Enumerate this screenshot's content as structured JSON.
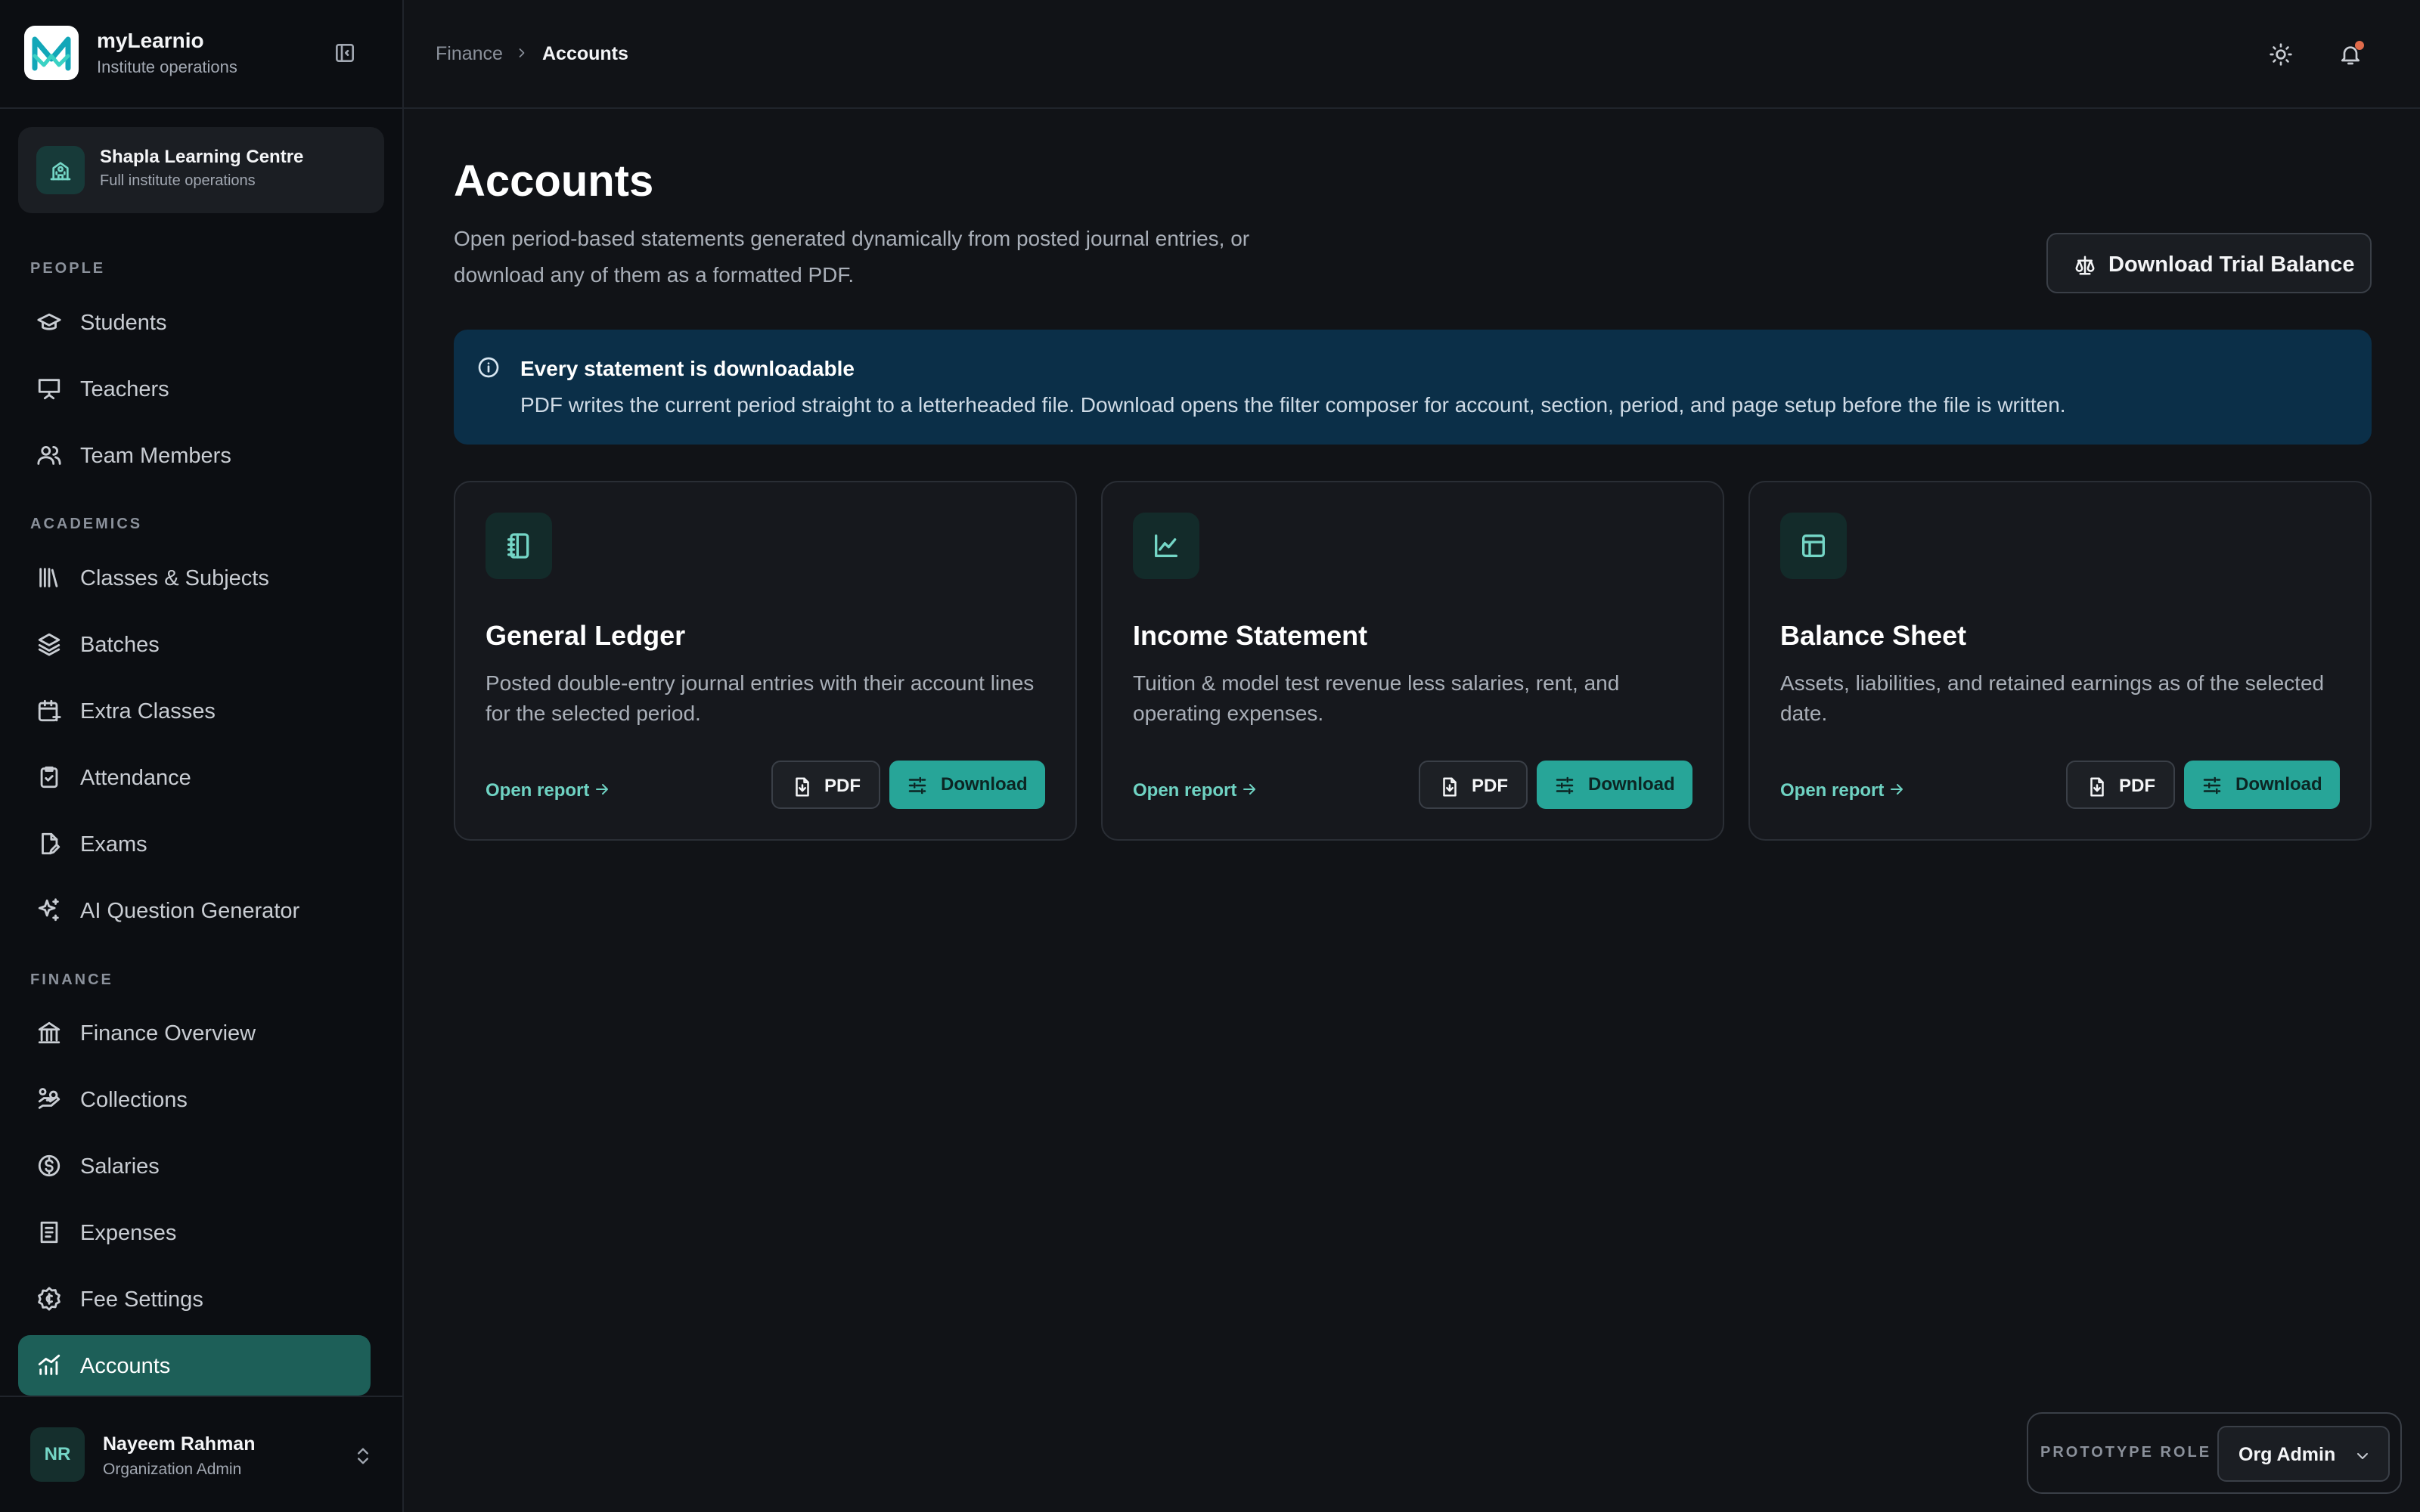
{
  "app": {
    "name": "myLearnio",
    "subtitle": "Institute operations"
  },
  "org": {
    "name": "Shapla Learning Centre",
    "subtitle": "Full institute operations"
  },
  "nav": {
    "sections": {
      "people": "PEOPLE",
      "academics": "ACADEMICS",
      "finance": "FINANCE"
    },
    "items": {
      "students": "Students",
      "teachers": "Teachers",
      "team_members": "Team Members",
      "classes_subjects": "Classes & Subjects",
      "batches": "Batches",
      "extra_classes": "Extra Classes",
      "attendance": "Attendance",
      "exams": "Exams",
      "ai_question_generator": "AI Question Generator",
      "finance_overview": "Finance Overview",
      "collections": "Collections",
      "salaries": "Salaries",
      "expenses": "Expenses",
      "fee_settings": "Fee Settings",
      "accounts": "Accounts"
    },
    "active": "accounts"
  },
  "user": {
    "initials": "NR",
    "name": "Nayeem Rahman",
    "role": "Organization Admin"
  },
  "breadcrumb": {
    "parent": "Finance",
    "current": "Accounts"
  },
  "page": {
    "title": "Accounts",
    "description": "Open period-based statements generated dynamically from posted journal entries, or download any of them as a formatted PDF.",
    "trial_balance_button": "Download Trial Balance"
  },
  "banner": {
    "title": "Every statement is downloadable",
    "text": "PDF writes the current period straight to a letterheaded file. Download opens the filter composer for account, section, period, and page setup before the file is written."
  },
  "cards": [
    {
      "title": "General Ledger",
      "description": "Posted double-entry journal entries with their account lines for the selected period.",
      "icon": "notebook-icon"
    },
    {
      "title": "Income Statement",
      "description": "Tuition & model test revenue less salaries, rent, and operating expenses.",
      "icon": "line-chart-icon"
    },
    {
      "title": "Balance Sheet",
      "description": "Assets, liabilities, and retained earnings as of the selected date.",
      "icon": "layout-icon"
    }
  ],
  "card_actions": {
    "open_report": "Open report",
    "pdf": "PDF",
    "download": "Download"
  },
  "role_switcher": {
    "label": "PROTOTYPE ROLE",
    "value": "Org Admin"
  },
  "colors": {
    "accent": "#27a598",
    "active_nav": "#1d5f58",
    "banner": "#0b2f48",
    "notification": "#e06b4b"
  }
}
